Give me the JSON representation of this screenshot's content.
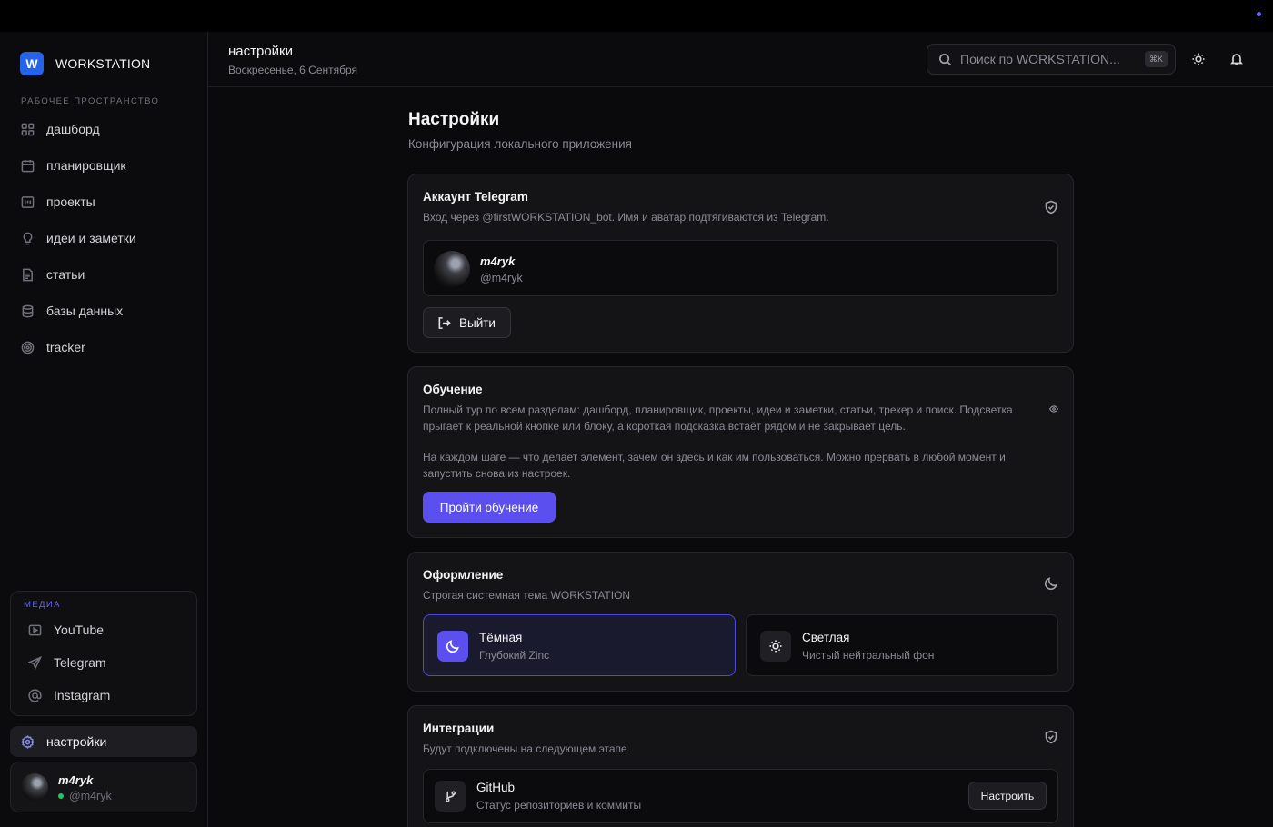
{
  "app": {
    "name": "WORKSTATION",
    "logo_letter": "W"
  },
  "sidebar": {
    "section_label": "РАБОЧЕЕ ПРОСТРАНСТВО",
    "items": [
      {
        "label": "дашборд",
        "icon": "dashboard-icon"
      },
      {
        "label": "планировщик",
        "icon": "calendar-icon"
      },
      {
        "label": "проекты",
        "icon": "projects-icon"
      },
      {
        "label": "идеи и заметки",
        "icon": "lightbulb-icon"
      },
      {
        "label": "статьи",
        "icon": "document-icon"
      },
      {
        "label": "базы данных",
        "icon": "database-icon"
      },
      {
        "label": "tracker",
        "icon": "target-icon"
      }
    ],
    "media": {
      "label": "МЕДИА",
      "items": [
        {
          "label": "YouTube",
          "icon": "youtube-icon"
        },
        {
          "label": "Telegram",
          "icon": "send-icon"
        },
        {
          "label": "Instagram",
          "icon": "at-sign-icon"
        }
      ]
    },
    "settings_label": "настройки",
    "user": {
      "name": "m4ryk",
      "handle": "@m4ryk"
    }
  },
  "header": {
    "title": "настройки",
    "date": "Воскресенье, 6 Сентября",
    "search_placeholder": "Поиск по WORKSTATION...",
    "search_shortcut": "⌘K"
  },
  "main": {
    "title": "Настройки",
    "subtitle": "Конфигурация локального приложения",
    "telegram": {
      "title": "Аккаунт Telegram",
      "subtitle": "Вход через @firstWORKSTATION_bot. Имя и аватар подтягиваются из Telegram.",
      "name": "m4ryk",
      "handle": "@m4ryk",
      "logout_label": "Выйти"
    },
    "tutorial": {
      "title": "Обучение",
      "paragraph1": "Полный тур по всем разделам: дашборд, планировщик, проекты, идеи и заметки, статьи, трекер и поиск. Подсветка прыгает к реальной кнопке или блоку, а короткая подсказка встаёт рядом и не закрывает цель.",
      "paragraph2": "На каждом шаге — что делает элемент, зачем он здесь и как им пользоваться. Можно прервать в любой момент и запустить снова из настроек.",
      "button_label": "Пройти обучение"
    },
    "appearance": {
      "title": "Оформление",
      "subtitle": "Строгая системная тема WORKSTATION",
      "dark": {
        "name": "Тёмная",
        "desc": "Глубокий Zinc"
      },
      "light": {
        "name": "Светлая",
        "desc": "Чистый нейтральный фон"
      },
      "selected": "dark"
    },
    "integrations": {
      "title": "Интеграции",
      "subtitle": "Будут подключены на следующем этапе",
      "items": [
        {
          "name": "GitHub",
          "desc": "Статус репозиториев и коммиты",
          "button": "Настроить"
        }
      ]
    }
  },
  "colors": {
    "accent": "#5b4ff0",
    "brand": "#2563eb",
    "online": "#22c55e"
  }
}
